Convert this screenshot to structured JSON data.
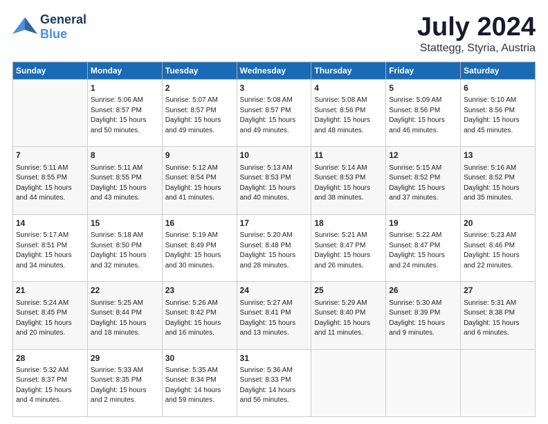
{
  "header": {
    "logo_general": "General",
    "logo_blue": "Blue",
    "title": "July 2024",
    "subtitle": "Stattegg, Styria, Austria"
  },
  "days_of_week": [
    "Sunday",
    "Monday",
    "Tuesday",
    "Wednesday",
    "Thursday",
    "Friday",
    "Saturday"
  ],
  "weeks": [
    [
      {
        "day": "",
        "content": ""
      },
      {
        "day": "1",
        "content": "Sunrise: 5:06 AM\nSunset: 8:57 PM\nDaylight: 15 hours\nand 50 minutes."
      },
      {
        "day": "2",
        "content": "Sunrise: 5:07 AM\nSunset: 8:57 PM\nDaylight: 15 hours\nand 49 minutes."
      },
      {
        "day": "3",
        "content": "Sunrise: 5:08 AM\nSunset: 8:57 PM\nDaylight: 15 hours\nand 49 minutes."
      },
      {
        "day": "4",
        "content": "Sunrise: 5:08 AM\nSunset: 8:56 PM\nDaylight: 15 hours\nand 48 minutes."
      },
      {
        "day": "5",
        "content": "Sunrise: 5:09 AM\nSunset: 8:56 PM\nDaylight: 15 hours\nand 46 minutes."
      },
      {
        "day": "6",
        "content": "Sunrise: 5:10 AM\nSunset: 8:56 PM\nDaylight: 15 hours\nand 45 minutes."
      }
    ],
    [
      {
        "day": "7",
        "content": "Sunrise: 5:11 AM\nSunset: 8:55 PM\nDaylight: 15 hours\nand 44 minutes."
      },
      {
        "day": "8",
        "content": "Sunrise: 5:11 AM\nSunset: 8:55 PM\nDaylight: 15 hours\nand 43 minutes."
      },
      {
        "day": "9",
        "content": "Sunrise: 5:12 AM\nSunset: 8:54 PM\nDaylight: 15 hours\nand 41 minutes."
      },
      {
        "day": "10",
        "content": "Sunrise: 5:13 AM\nSunset: 8:53 PM\nDaylight: 15 hours\nand 40 minutes."
      },
      {
        "day": "11",
        "content": "Sunrise: 5:14 AM\nSunset: 8:53 PM\nDaylight: 15 hours\nand 38 minutes."
      },
      {
        "day": "12",
        "content": "Sunrise: 5:15 AM\nSunset: 8:52 PM\nDaylight: 15 hours\nand 37 minutes."
      },
      {
        "day": "13",
        "content": "Sunrise: 5:16 AM\nSunset: 8:52 PM\nDaylight: 15 hours\nand 35 minutes."
      }
    ],
    [
      {
        "day": "14",
        "content": "Sunrise: 5:17 AM\nSunset: 8:51 PM\nDaylight: 15 hours\nand 34 minutes."
      },
      {
        "day": "15",
        "content": "Sunrise: 5:18 AM\nSunset: 8:50 PM\nDaylight: 15 hours\nand 32 minutes."
      },
      {
        "day": "16",
        "content": "Sunrise: 5:19 AM\nSunset: 8:49 PM\nDaylight: 15 hours\nand 30 minutes."
      },
      {
        "day": "17",
        "content": "Sunrise: 5:20 AM\nSunset: 8:48 PM\nDaylight: 15 hours\nand 28 minutes."
      },
      {
        "day": "18",
        "content": "Sunrise: 5:21 AM\nSunset: 8:47 PM\nDaylight: 15 hours\nand 26 minutes."
      },
      {
        "day": "19",
        "content": "Sunrise: 5:22 AM\nSunset: 8:47 PM\nDaylight: 15 hours\nand 24 minutes."
      },
      {
        "day": "20",
        "content": "Sunrise: 5:23 AM\nSunset: 8:46 PM\nDaylight: 15 hours\nand 22 minutes."
      }
    ],
    [
      {
        "day": "21",
        "content": "Sunrise: 5:24 AM\nSunset: 8:45 PM\nDaylight: 15 hours\nand 20 minutes."
      },
      {
        "day": "22",
        "content": "Sunrise: 5:25 AM\nSunset: 8:44 PM\nDaylight: 15 hours\nand 18 minutes."
      },
      {
        "day": "23",
        "content": "Sunrise: 5:26 AM\nSunset: 8:42 PM\nDaylight: 15 hours\nand 16 minutes."
      },
      {
        "day": "24",
        "content": "Sunrise: 5:27 AM\nSunset: 8:41 PM\nDaylight: 15 hours\nand 13 minutes."
      },
      {
        "day": "25",
        "content": "Sunrise: 5:29 AM\nSunset: 8:40 PM\nDaylight: 15 hours\nand 11 minutes."
      },
      {
        "day": "26",
        "content": "Sunrise: 5:30 AM\nSunset: 8:39 PM\nDaylight: 15 hours\nand 9 minutes."
      },
      {
        "day": "27",
        "content": "Sunrise: 5:31 AM\nSunset: 8:38 PM\nDaylight: 15 hours\nand 6 minutes."
      }
    ],
    [
      {
        "day": "28",
        "content": "Sunrise: 5:32 AM\nSunset: 8:37 PM\nDaylight: 15 hours\nand 4 minutes."
      },
      {
        "day": "29",
        "content": "Sunrise: 5:33 AM\nSunset: 8:35 PM\nDaylight: 15 hours\nand 2 minutes."
      },
      {
        "day": "30",
        "content": "Sunrise: 5:35 AM\nSunset: 8:34 PM\nDaylight: 14 hours\nand 59 minutes."
      },
      {
        "day": "31",
        "content": "Sunrise: 5:36 AM\nSunset: 8:33 PM\nDaylight: 14 hours\nand 56 minutes."
      },
      {
        "day": "",
        "content": ""
      },
      {
        "day": "",
        "content": ""
      },
      {
        "day": "",
        "content": ""
      }
    ]
  ]
}
